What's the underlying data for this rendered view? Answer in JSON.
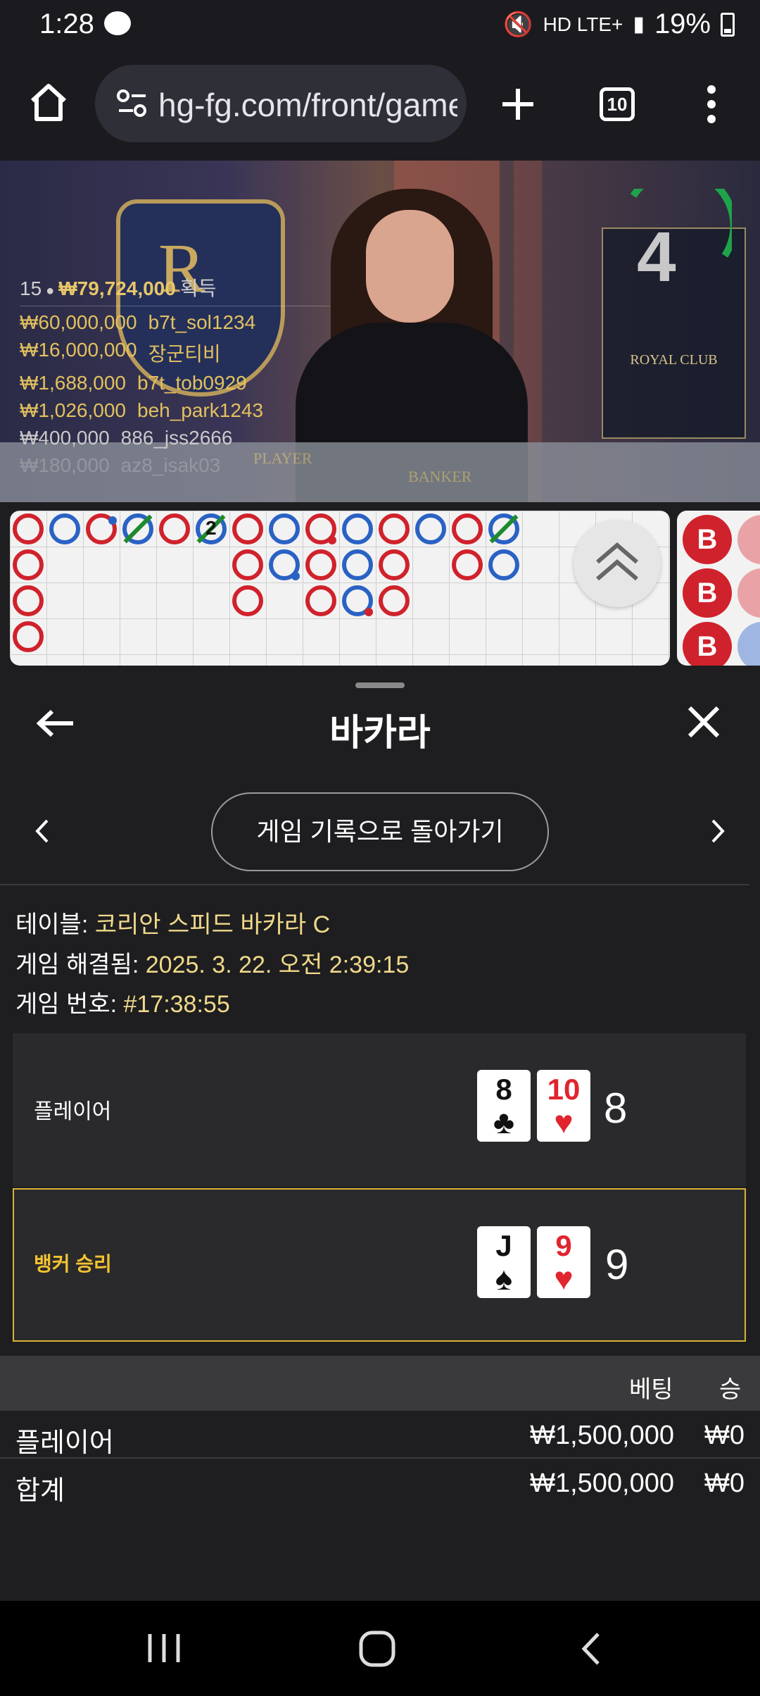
{
  "status": {
    "time": "1:28",
    "right_text": "HD LTE+",
    "battery": "19%"
  },
  "browser": {
    "url": "hg-fg.com/front/game",
    "tab_count": "10"
  },
  "video": {
    "timer": "4",
    "table_labels": [
      "PLAYER",
      "BANKER"
    ],
    "royal_box_text": "ROYAL CLUB",
    "leaderboard": {
      "count": "15",
      "total": "₩79,724,000",
      "suffix": "획득",
      "rows": [
        {
          "amount": "₩60,000,000",
          "name": "b7t_sol1234"
        },
        {
          "amount": "₩16,000,000",
          "name": "장군티비"
        },
        {
          "amount": "₩1,688,000",
          "name": "b7t_tob0929"
        },
        {
          "amount": "₩1,026,000",
          "name": "beh_park1243"
        },
        {
          "amount": "₩400,000",
          "name": "886_jss2666"
        },
        {
          "amount": "₩180,000",
          "name": "az8_isak03"
        }
      ]
    }
  },
  "road": {
    "tie_count": "2",
    "side_letter": "B"
  },
  "sheet": {
    "title": "바카라",
    "history_button": "게임 기록으로 돌아가기",
    "info": {
      "table_label": "테이블:",
      "table_value": "코리안 스피드 바카라 C",
      "resolved_label": "게임 해결됨:",
      "resolved_value": "2025. 3. 22. 오전 2:39:15",
      "number_label": "게임 번호:",
      "number_value": "#17:38:55"
    },
    "hands": {
      "player": {
        "label": "플레이어",
        "score": "8",
        "cards": [
          {
            "rank": "8",
            "suit": "♣"
          },
          {
            "rank": "10",
            "suit": "♥"
          }
        ]
      },
      "banker": {
        "label": "뱅커 승리",
        "score": "9",
        "cards": [
          {
            "rank": "J",
            "suit": "♠"
          },
          {
            "rank": "9",
            "suit": "♥"
          }
        ]
      }
    },
    "bets": {
      "col_bet": "베팅",
      "col_win": "승",
      "rows": [
        {
          "name": "플레이어",
          "bet": "₩1,500,000",
          "win": "₩0"
        },
        {
          "name": "합계",
          "bet": "₩1,500,000",
          "win": "₩0"
        }
      ]
    }
  },
  "colors": {
    "accent_gold": "#f0d98a",
    "banker_red": "#d0222c",
    "player_blue": "#2a62c4",
    "highlight_border": "#d8b336"
  }
}
